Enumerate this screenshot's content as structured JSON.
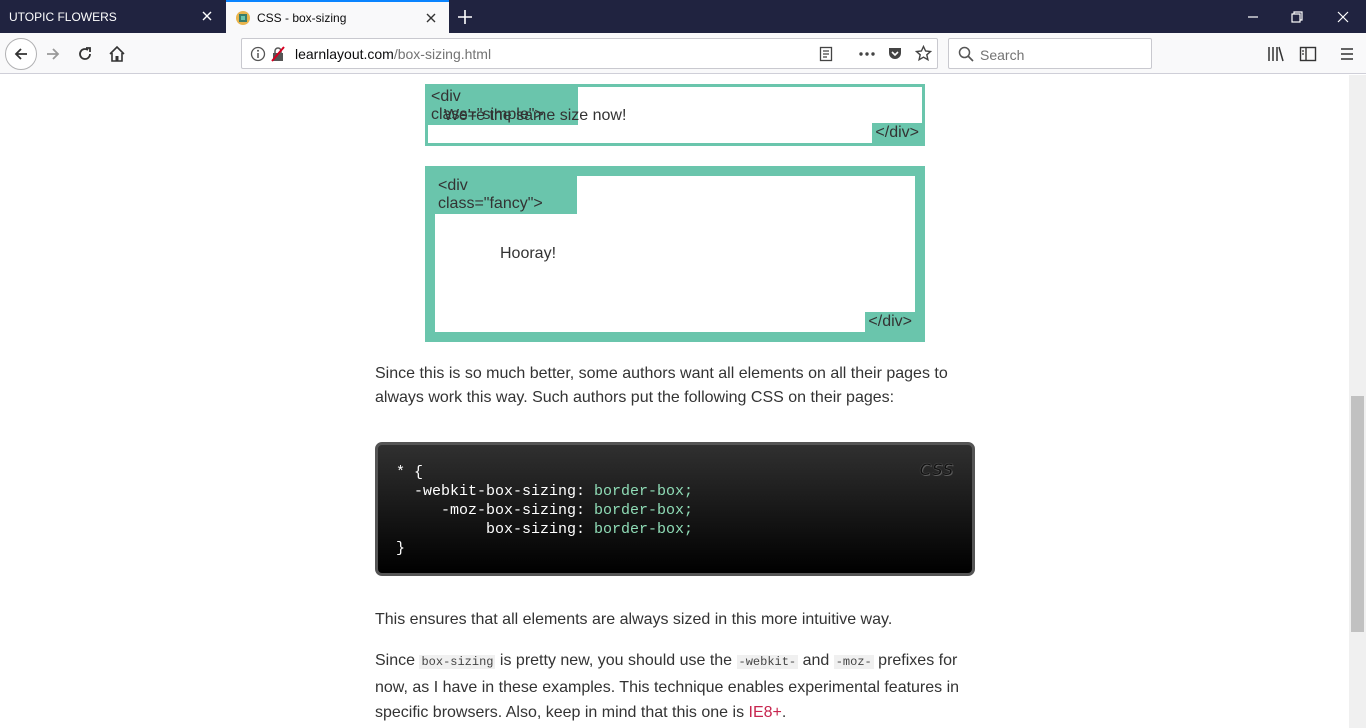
{
  "browser": {
    "tabs": [
      {
        "title": "UTOPIC FLOWERS",
        "active": false
      },
      {
        "title": "CSS - box-sizing",
        "active": true
      }
    ],
    "url_host": "learnlayout.com",
    "url_path": "/box-sizing.html",
    "search_placeholder": "Search"
  },
  "page": {
    "simple_box": {
      "open_tag": "<div class=\"simple\">",
      "text": "We're the same size now!",
      "close_tag": "</div>"
    },
    "fancy_box": {
      "open_tag": "<div class=\"fancy\">",
      "text": "Hooray!",
      "close_tag": "</div>"
    },
    "para1": "Since this is so much better, some authors want all elements on all their pages to always work this way. Such authors put the following CSS on their pages:",
    "code": {
      "lang": "CSS",
      "lines": [
        {
          "prop": "* {",
          "val": ""
        },
        {
          "prop": "  -webkit-box-sizing: ",
          "val": "border-box;"
        },
        {
          "prop": "     -moz-box-sizing: ",
          "val": "border-box;"
        },
        {
          "prop": "          box-sizing: ",
          "val": "border-box;"
        },
        {
          "prop": "}",
          "val": ""
        }
      ]
    },
    "para2": "This ensures that all elements are always sized in this more intuitive way.",
    "para3": {
      "t1": "Since ",
      "c1": "box-sizing",
      "t2": " is pretty new, you should use the ",
      "c2": "-webkit-",
      "t3": " and ",
      "c3": "-moz-",
      "t4": " prefixes for now, as I have in these examples. This technique enables experimental features in specific browsers. Also, keep in mind that this one is ",
      "link": "IE8+",
      "t5": "."
    }
  },
  "colors": {
    "accent": "#6ac5ac",
    "code_value": "#8fdcb6",
    "link": "#c7254e"
  }
}
